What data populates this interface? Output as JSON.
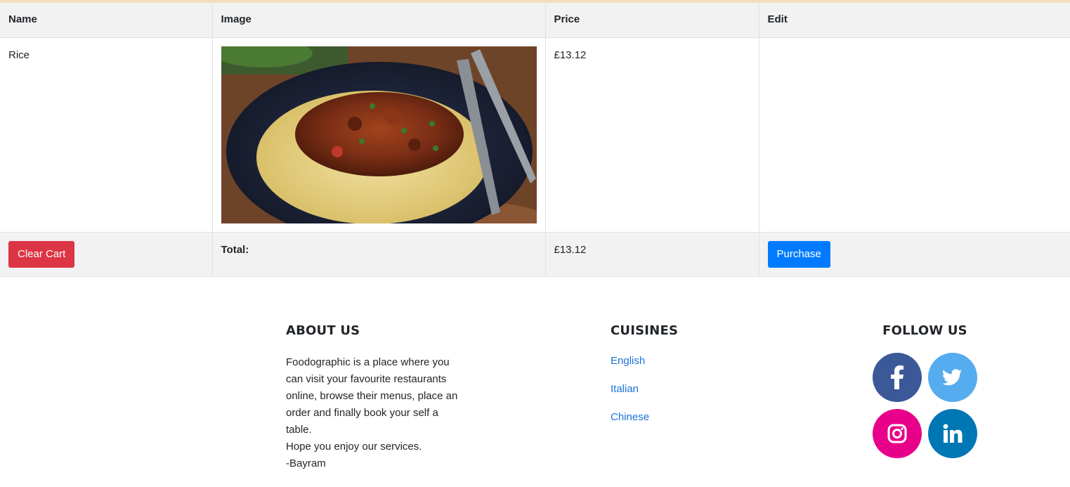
{
  "table": {
    "headers": {
      "name": "Name",
      "image": "Image",
      "price": "Price",
      "edit": "Edit"
    },
    "items": [
      {
        "name": "Rice",
        "image_alt": "rice-dish-photo",
        "price": "£13.12"
      }
    ],
    "footer": {
      "clear_label": "Clear Cart",
      "total_label": "Total:",
      "total_value": "£13.12",
      "purchase_label": "Purchase"
    }
  },
  "site_footer": {
    "about": {
      "title": "ABOUT US",
      "line1": "Foodographic is a place where you can visit your favourite restaurants online, browse their menus, place an order and finally book your self a table.",
      "line2": "Hope you enjoy our services.",
      "line3": "-Bayram"
    },
    "cuisines": {
      "title": "CUISINES",
      "links": [
        "English",
        "Italian",
        "Chinese"
      ]
    },
    "follow": {
      "title": "FOLLOW US",
      "icons": [
        "facebook-icon",
        "twitter-icon",
        "instagram-icon",
        "linkedin-icon"
      ]
    }
  },
  "colors": {
    "danger": "#dc3545",
    "primary": "#007bff",
    "link": "#1a73d9",
    "facebook": "#3b5998",
    "twitter": "#55acee",
    "instagram": "#e9008a",
    "linkedin": "#0077b5"
  }
}
